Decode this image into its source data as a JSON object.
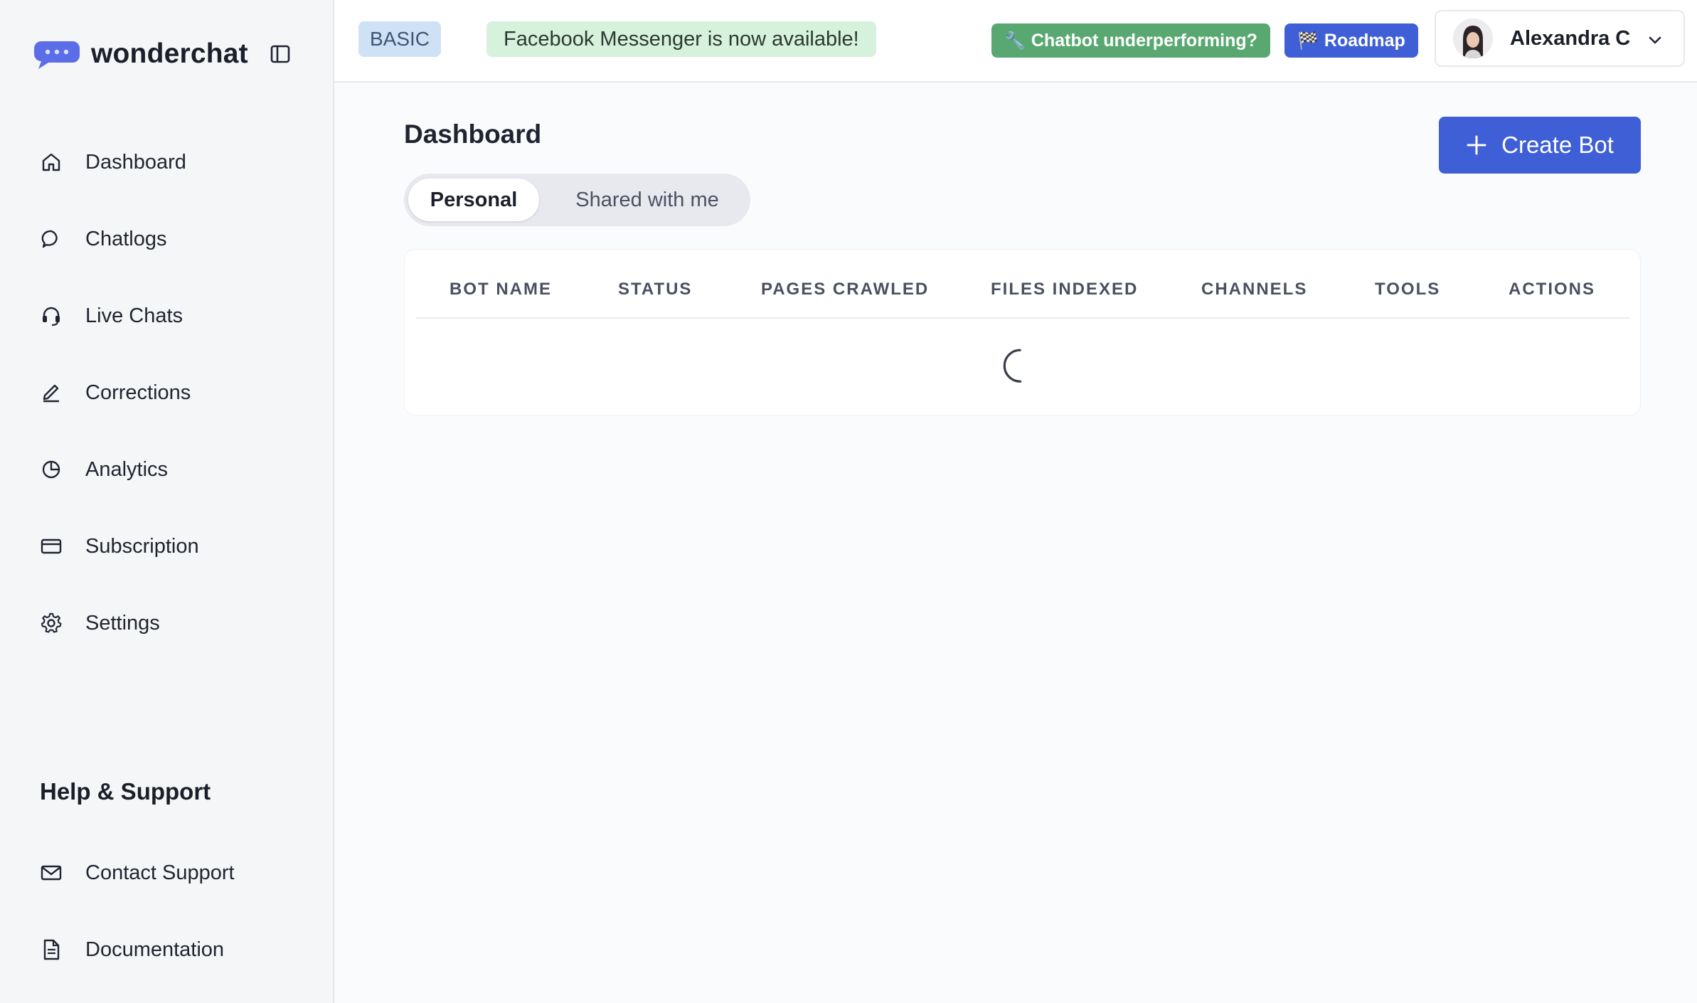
{
  "brand": {
    "name": "wonderchat",
    "logo_icon": "chat-bubble-logo-icon"
  },
  "sidebar": {
    "items": [
      {
        "label": "Dashboard",
        "icon": "home-icon"
      },
      {
        "label": "Chatlogs",
        "icon": "chat-bubble-icon"
      },
      {
        "label": "Live Chats",
        "icon": "headset-icon"
      },
      {
        "label": "Corrections",
        "icon": "pencil-icon"
      },
      {
        "label": "Analytics",
        "icon": "pie-chart-icon"
      },
      {
        "label": "Subscription",
        "icon": "credit-card-icon"
      },
      {
        "label": "Settings",
        "icon": "gear-icon"
      }
    ],
    "help_title": "Help & Support",
    "help_items": [
      {
        "label": "Contact Support",
        "icon": "mail-icon"
      },
      {
        "label": "Documentation",
        "icon": "document-icon"
      }
    ]
  },
  "topbar": {
    "plan_badge": "BASIC",
    "announcement": "Facebook Messenger is now available!",
    "underperforming_icon": "🔧",
    "underperforming_label": "Chatbot underperforming?",
    "roadmap_icon": "🏁",
    "roadmap_label": "Roadmap",
    "user_name": "Alexandra C"
  },
  "main": {
    "title": "Dashboard",
    "create_button": "Create Bot",
    "tabs": [
      {
        "label": "Personal",
        "active": true
      },
      {
        "label": "Shared with me",
        "active": false
      }
    ],
    "table": {
      "columns": [
        "BOT NAME",
        "STATUS",
        "PAGES CRAWLED",
        "FILES INDEXED",
        "CHANNELS",
        "TOOLS",
        "ACTIONS"
      ],
      "rows": [],
      "loading": true
    }
  },
  "colors": {
    "accent": "#3f5fd6",
    "success": "#5aa871",
    "badge_bg": "#cfe1f5",
    "announce_bg": "#d6f1dc"
  }
}
